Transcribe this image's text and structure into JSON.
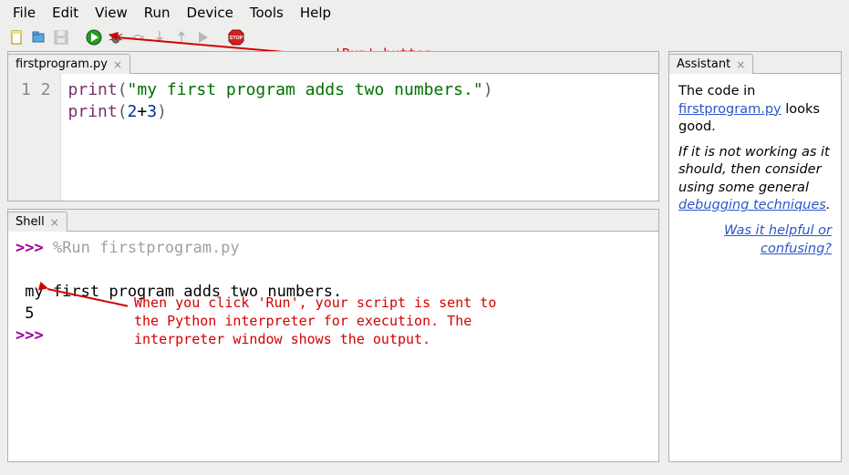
{
  "menubar": [
    "File",
    "Edit",
    "View",
    "Run",
    "Device",
    "Tools",
    "Help"
  ],
  "toolbar": {
    "new_icon": "new-file-icon",
    "open_icon": "open-file-icon",
    "save_icon": "save-icon",
    "run_icon": "run-icon",
    "debug_icon": "debug-icon",
    "step_over_icon": "step-over-icon",
    "step_into_icon": "step-into-icon",
    "step_out_icon": "step-out-icon",
    "resume_icon": "resume-icon",
    "stop_icon": "stop-icon"
  },
  "annotations": {
    "run_label": "'Run' button",
    "shell_note": "When you click 'Run', your script is sent to\nthe Python interpreter for execution. The\ninterpreter window shows the output."
  },
  "editor": {
    "tab_label": "firstprogram.py",
    "line_numbers": [
      "1",
      "2"
    ],
    "code_tokens": [
      [
        {
          "t": "print",
          "c": "tok-fn"
        },
        {
          "t": "(",
          "c": "tok-paren"
        },
        {
          "t": "\"my first program adds two numbers.\"",
          "c": "tok-str"
        },
        {
          "t": ")",
          "c": "tok-paren"
        }
      ],
      [
        {
          "t": "print",
          "c": "tok-fn"
        },
        {
          "t": "(",
          "c": "tok-paren"
        },
        {
          "t": "2",
          "c": "tok-num"
        },
        {
          "t": "+",
          "c": ""
        },
        {
          "t": "3",
          "c": "tok-num"
        },
        {
          "t": ")",
          "c": "tok-paren"
        }
      ]
    ]
  },
  "shell": {
    "tab_label": "Shell",
    "prompt": ">>>",
    "run_cmd": "%Run firstprogram.py",
    "output_lines": [
      " my first program adds two numbers.",
      " 5"
    ]
  },
  "assistant": {
    "tab_label": "Assistant",
    "p1_pre": "The code in ",
    "p1_link": "firstprogram.py",
    "p1_post": " looks good.",
    "p2_pre": "If it is not working as it should, then consider using some general ",
    "p2_link": "debugging techniques",
    "p2_post": ".",
    "feedback": "Was it helpful or confusing?"
  }
}
